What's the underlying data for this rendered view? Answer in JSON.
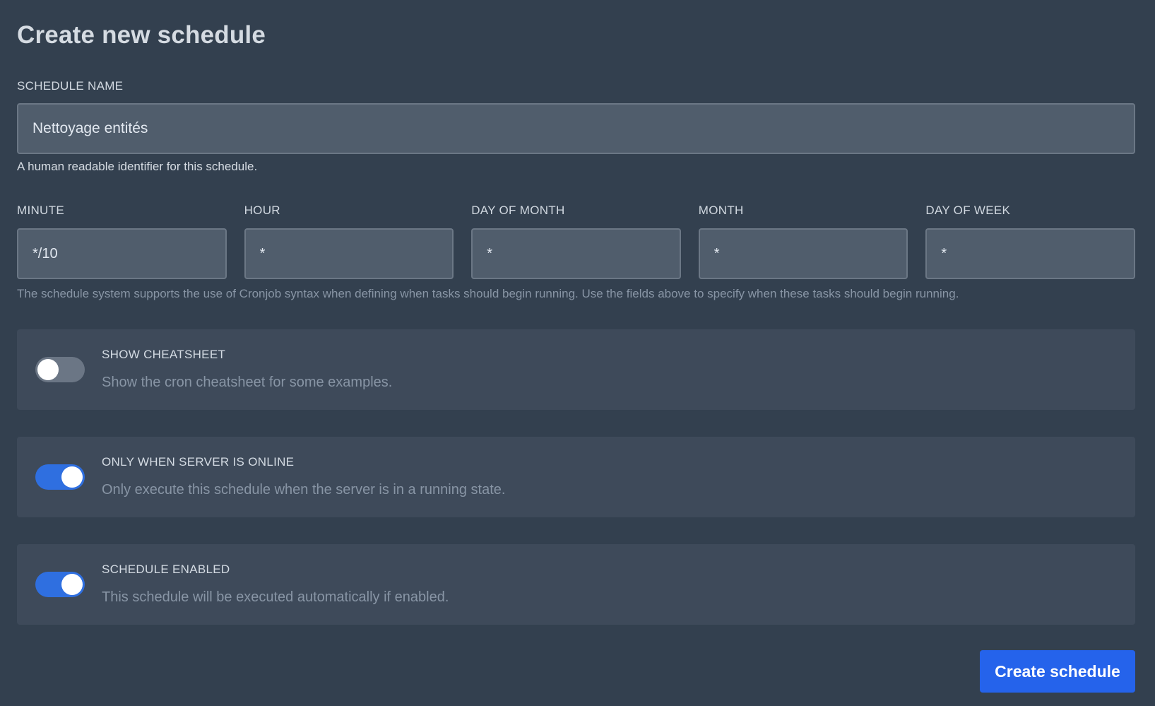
{
  "page_title": "Create new schedule",
  "schedule_name": {
    "label": "SCHEDULE NAME",
    "value": "Nettoyage entités",
    "help": "A human readable identifier for this schedule."
  },
  "cron": {
    "minute": {
      "label": "MINUTE",
      "value": "*/10"
    },
    "hour": {
      "label": "HOUR",
      "value": "*"
    },
    "day_of_month": {
      "label": "DAY OF MONTH",
      "value": "*"
    },
    "month": {
      "label": "MONTH",
      "value": "*"
    },
    "day_of_week": {
      "label": "DAY OF WEEK",
      "value": "*"
    },
    "help": "The schedule system supports the use of Cronjob syntax when defining when tasks should begin running. Use the fields above to specify when these tasks should begin running."
  },
  "toggles": [
    {
      "title": "SHOW CHEATSHEET",
      "description": "Show the cron cheatsheet for some examples.",
      "enabled": false
    },
    {
      "title": "ONLY WHEN SERVER IS ONLINE",
      "description": "Only execute this schedule when the server is in a running state.",
      "enabled": true
    },
    {
      "title": "SCHEDULE ENABLED",
      "description": "This schedule will be executed automatically if enabled.",
      "enabled": true
    }
  ],
  "submit_label": "Create schedule",
  "colors": {
    "background": "#33404f",
    "panel": "#3e4a5a",
    "input": "#505d6c",
    "accent": "#2563eb",
    "toggle_on": "#2f6fe0",
    "toggle_off": "#6b7685"
  }
}
